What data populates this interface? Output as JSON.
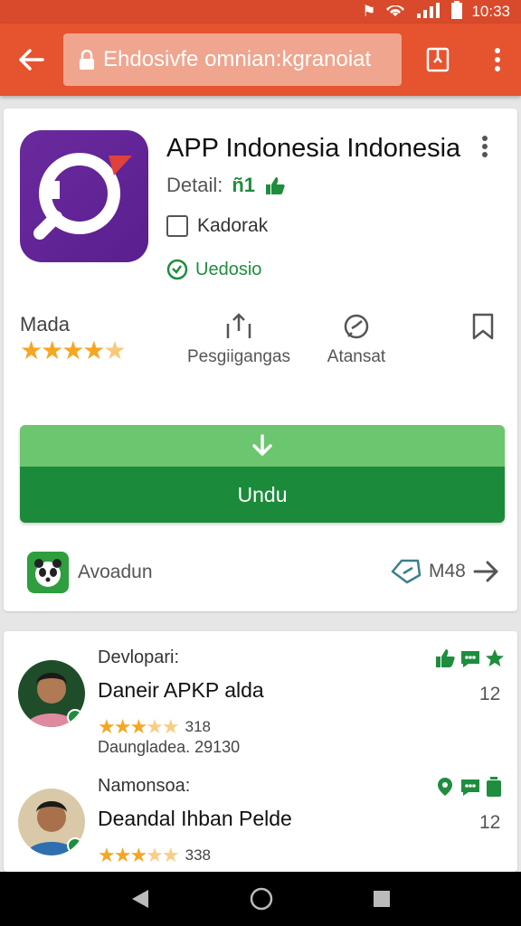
{
  "status_bar": {
    "time": "10:33"
  },
  "app_bar": {
    "url": "Ehdosivfe omnian:kgranoiat"
  },
  "app": {
    "title": "APP Indonesia Indonesia",
    "detail_label": "Detail:",
    "detail_value": "ñ1",
    "checkbox_label": "Kadorak",
    "update_label": "Uedosio"
  },
  "rating": {
    "label": "Mada",
    "stars": 4.5
  },
  "stats": {
    "share_label": "Pesgiigangas",
    "rate_label": "Atansat"
  },
  "download": {
    "label": "Undu"
  },
  "availability": {
    "label": "Avoadun",
    "size": "M48"
  },
  "developers": [
    {
      "label": "Devlopari:",
      "name": "Daneir APKP alda",
      "rating_count": "318",
      "sub": "Daungladea. 29130",
      "num": "12",
      "rating": 3.5
    },
    {
      "label": "Namonsoa:",
      "name": "Deandal Ihban Pelde",
      "rating_count": "338",
      "sub": "",
      "num": "12",
      "rating": 3.5
    }
  ],
  "colors": {
    "app_bar": "#e5532f",
    "status_bar": "#d84a2b",
    "accent_green": "#1b8a3a",
    "icon_purple": "#5a1f8e",
    "star": "#f5a623"
  }
}
